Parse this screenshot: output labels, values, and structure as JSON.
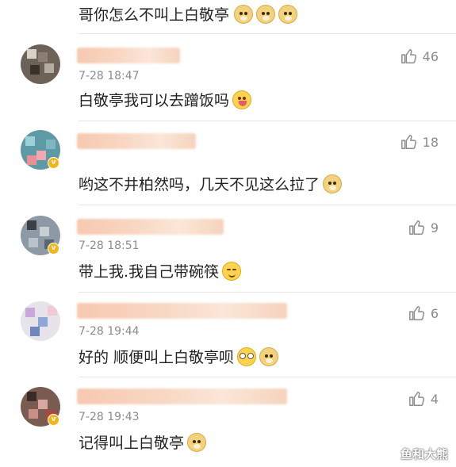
{
  "top_comment": {
    "text": "哥你怎么不叫上白敬亭",
    "emojis": [
      "doge",
      "doge",
      "doge"
    ]
  },
  "comments": [
    {
      "time": "7-28 18:47",
      "text": "白敬亭我可以去蹭饭吗",
      "emojis": [
        "tongue"
      ],
      "likes": "46",
      "verified": false
    },
    {
      "time": "",
      "text": "哟这不井柏然吗，几天不见这么拉了",
      "emojis": [
        "doge"
      ],
      "likes": "18",
      "verified": true
    },
    {
      "time": "7-28 18:51",
      "text": "带上我.我自己带碗筷",
      "emojis": [
        "smile"
      ],
      "likes": "9",
      "verified": true
    },
    {
      "time": "7-28 19:44",
      "text": "好的 顺便叫上白敬亭呗",
      "emojis": [
        "glasses",
        "doge"
      ],
      "likes": "6",
      "verified": false
    },
    {
      "time": "7-28 19:43",
      "text": "记得叫上白敬亭",
      "emojis": [
        "doge"
      ],
      "likes": "4",
      "verified": true
    }
  ],
  "icons": {
    "like": "thumbs-up-icon",
    "verified": "verified-badge-icon"
  },
  "colors": {
    "text": "#222222",
    "meta": "#8c8c8c",
    "badge": "#f2b619",
    "divider": "#e6e6e6"
  },
  "watermark": "鱼和大熊"
}
